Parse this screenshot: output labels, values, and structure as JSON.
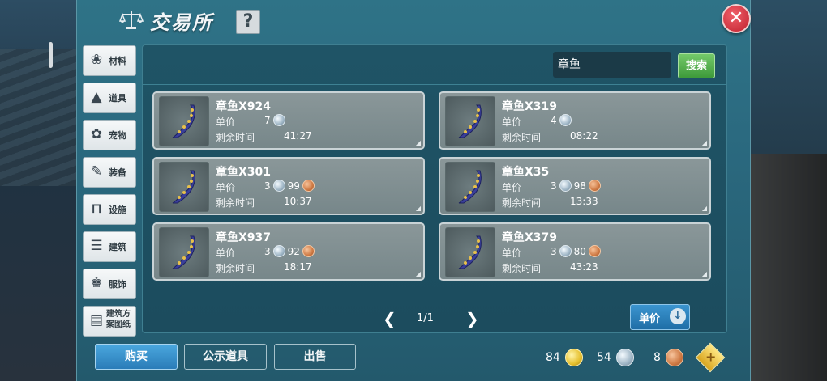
{
  "window": {
    "title": "交易所",
    "help_label": "?",
    "close_label": "✕"
  },
  "sidebar": {
    "items": [
      {
        "label": "材料",
        "icon": "material-icon"
      },
      {
        "label": "道具",
        "icon": "item-icon"
      },
      {
        "label": "宠物",
        "icon": "pet-icon"
      },
      {
        "label": "装备",
        "icon": "equipment-icon"
      },
      {
        "label": "设施",
        "icon": "facility-icon"
      },
      {
        "label": "建筑",
        "icon": "building-icon"
      },
      {
        "label": "服饰",
        "icon": "clothing-icon"
      },
      {
        "label": "建筑方案图纸",
        "icon": "blueprint-icon"
      }
    ]
  },
  "search": {
    "value": "章鱼",
    "button_label": "搜索"
  },
  "listings": [
    {
      "name": "章鱼X924",
      "price_label": "单价",
      "silver": "7",
      "copper": "",
      "time_label": "剩余时间",
      "time": "41:27"
    },
    {
      "name": "章鱼X319",
      "price_label": "单价",
      "silver": "4",
      "copper": "",
      "time_label": "剩余时间",
      "time": "08:22"
    },
    {
      "name": "章鱼X301",
      "price_label": "单价",
      "silver": "3",
      "copper": "99",
      "time_label": "剩余时间",
      "time": "10:37"
    },
    {
      "name": "章鱼X35",
      "price_label": "单价",
      "silver": "3",
      "copper": "98",
      "time_label": "剩余时间",
      "time": "13:33"
    },
    {
      "name": "章鱼X937",
      "price_label": "单价",
      "silver": "3",
      "copper": "92",
      "time_label": "剩余时间",
      "time": "18:17"
    },
    {
      "name": "章鱼X379",
      "price_label": "单价",
      "silver": "3",
      "copper": "80",
      "time_label": "剩余时间",
      "time": "43:23"
    }
  ],
  "pager": {
    "text": "1/1",
    "prev": "❮",
    "next": "❯"
  },
  "sort": {
    "label": "单价",
    "arrow": "↓"
  },
  "tabs": {
    "buy": "购买",
    "public": "公示道具",
    "sell": "出售"
  },
  "currency": {
    "gold": "84",
    "silver": "54",
    "copper": "8",
    "add_label": "+"
  },
  "colors": {
    "accent": "#2a7cb8",
    "search_green": "#3e9a3a",
    "close_red": "#c0202e"
  }
}
